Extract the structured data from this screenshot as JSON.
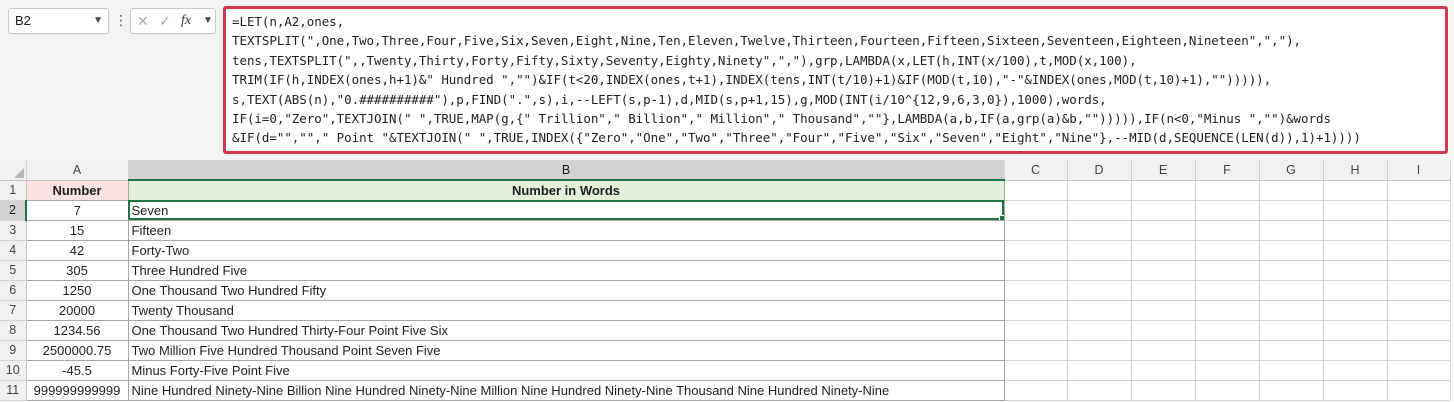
{
  "namebox": {
    "value": "B2",
    "chevron_icon": "chevron-down-icon"
  },
  "formula_bar": {
    "more_icon": "⋮",
    "cancel_icon": "✕",
    "enter_icon": "✓",
    "fx_label": "fx",
    "expand_icon": "chevron-down-icon",
    "lines": [
      "=LET(n,A2,ones,",
      "TEXTSPLIT(\",One,Two,Three,Four,Five,Six,Seven,Eight,Nine,Ten,Eleven,Twelve,Thirteen,Fourteen,Fifteen,Sixteen,Seventeen,Eighteen,Nineteen\",\",\"),",
      "tens,TEXTSPLIT(\",,Twenty,Thirty,Forty,Fifty,Sixty,Seventy,Eighty,Ninety\",\",\"),grp,LAMBDA(x,LET(h,INT(x/100),t,MOD(x,100),",
      "TRIM(IF(h,INDEX(ones,h+1)&\" Hundred \",\"\")&IF(t<20,INDEX(ones,t+1),INDEX(tens,INT(t/10)+1)&IF(MOD(t,10),\"-\"&INDEX(ones,MOD(t,10)+1),\"\"))))),",
      "s,TEXT(ABS(n),\"0.##########\"),p,FIND(\".\",s),i,--LEFT(s,p-1),d,MID(s,p+1,15),g,MOD(INT(i/10^{12,9,6,3,0}),1000),words,",
      "IF(i=0,\"Zero\",TEXTJOIN(\" \",TRUE,MAP(g,{\" Trillion\",\" Billion\",\" Million\",\" Thousand\",\"\"},LAMBDA(a,b,IF(a,grp(a)&b,\"\"))))),IF(n<0,\"Minus \",\"\")&words",
      "&IF(d=\"\",\"\",\" Point \"&TEXTJOIN(\" \",TRUE,INDEX({\"Zero\",\"One\",\"Two\",\"Three\",\"Four\",\"Five\",\"Six\",\"Seven\",\"Eight\",\"Nine\"},--MID(d,SEQUENCE(LEN(d)),1)+1))))"
    ]
  },
  "sheet": {
    "columns": [
      "A",
      "B",
      "C",
      "D",
      "E",
      "F",
      "G",
      "H",
      "I"
    ],
    "header_row": {
      "row": "1",
      "a": "Number",
      "b": "Number in Words"
    },
    "rows": [
      {
        "row": "2",
        "a": "7",
        "b": "Seven"
      },
      {
        "row": "3",
        "a": "15",
        "b": "Fifteen"
      },
      {
        "row": "4",
        "a": "42",
        "b": "Forty-Two"
      },
      {
        "row": "5",
        "a": "305",
        "b": "Three Hundred Five"
      },
      {
        "row": "6",
        "a": "1250",
        "b": "One Thousand Two Hundred Fifty"
      },
      {
        "row": "7",
        "a": "20000",
        "b": "Twenty Thousand"
      },
      {
        "row": "8",
        "a": "1234.56",
        "b": "One Thousand Two Hundred Thirty-Four Point Five Six"
      },
      {
        "row": "9",
        "a": "2500000.75",
        "b": "Two Million Five Hundred Thousand Point Seven Five"
      },
      {
        "row": "10",
        "a": "-45.5",
        "b": "Minus Forty-Five Point Five"
      },
      {
        "row": "11",
        "a": "999999999999",
        "b": "Nine Hundred Ninety-Nine Billion Nine Hundred Ninety-Nine Million Nine Hundred Ninety-Nine Thousand Nine Hundred Ninety-Nine"
      }
    ],
    "selected_cell": "B2",
    "colors": {
      "header_a_fill": "#fbe2e2",
      "header_b_fill": "#e2efd9",
      "selection": "#217346",
      "formula_highlight": "#d0364d"
    }
  }
}
